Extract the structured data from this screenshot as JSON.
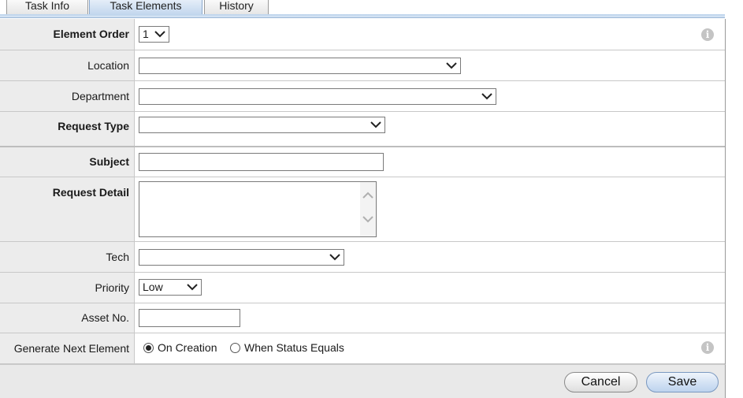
{
  "tabs": [
    {
      "label": "Task Info"
    },
    {
      "label": "Task Elements"
    },
    {
      "label": "History"
    }
  ],
  "form": {
    "element_order": {
      "label": "Element Order",
      "value": "1"
    },
    "location": {
      "label": "Location",
      "value": ""
    },
    "department": {
      "label": "Department",
      "value": ""
    },
    "request_type": {
      "label": "Request Type",
      "value": ""
    },
    "subject": {
      "label": "Subject",
      "value": ""
    },
    "request_detail": {
      "label": "Request Detail",
      "value": ""
    },
    "tech": {
      "label": "Tech",
      "value": ""
    },
    "priority": {
      "label": "Priority",
      "value": "Low"
    },
    "asset_no": {
      "label": "Asset No.",
      "value": ""
    },
    "generate_next": {
      "label": "Generate Next Element",
      "options": [
        "On Creation",
        "When Status Equals"
      ],
      "selected": "On Creation"
    }
  },
  "footer": {
    "cancel_label": "Cancel",
    "save_label": "Save"
  },
  "colors": {
    "tab_active": "#c3d7ee",
    "label_bg": "#ececec",
    "footer_bg": "#e9e9e9"
  }
}
